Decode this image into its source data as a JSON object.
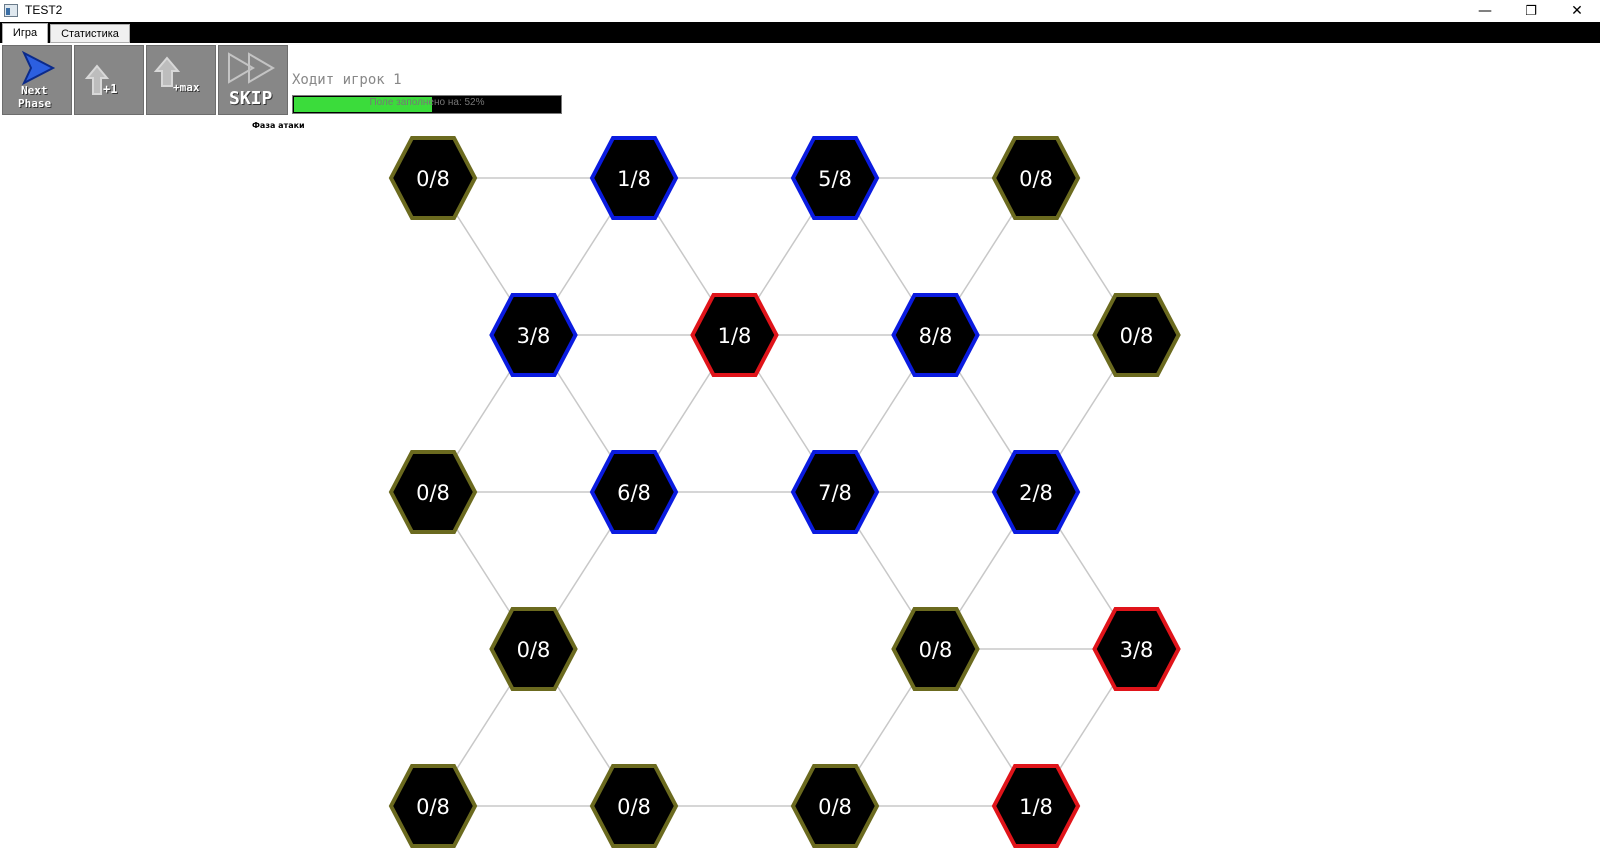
{
  "window": {
    "title": "TEST2",
    "controls": {
      "minimize": "—",
      "maximize": "❐",
      "close": "✕"
    }
  },
  "tabs": [
    {
      "label": "Игра",
      "active": true
    },
    {
      "label": "Статистика",
      "active": false
    }
  ],
  "toolbar": {
    "next_phase": {
      "line1": "Next",
      "line2": "Phase",
      "icon": "play-arrow-icon"
    },
    "plus_one": {
      "label": "+1",
      "icon": "up-arrow-icon"
    },
    "plus_max": {
      "label": "+max",
      "icon": "up-arrow-icon"
    },
    "skip": {
      "label": "SKIP",
      "icon": "double-arrow-icon"
    }
  },
  "status": {
    "player_turn": "Ходит игрок 1",
    "fill_text": "Поле заполнено на: 52%",
    "fill_fraction": 0.52,
    "phase_caption": "Фаза атаки"
  },
  "colors": {
    "neutral": "#6b6a1f",
    "blue": "#0a1be0",
    "red": "#e0141a",
    "link": "#c8c8c8",
    "hex_fill": "#000000",
    "bar_fill": "#3bdc3b"
  },
  "board": {
    "cells": [
      {
        "id": "r0c0",
        "row": 0,
        "col": 0,
        "value": "0/8",
        "owner": "neutral"
      },
      {
        "id": "r0c1",
        "row": 0,
        "col": 1,
        "value": "1/8",
        "owner": "blue"
      },
      {
        "id": "r0c2",
        "row": 0,
        "col": 2,
        "value": "5/8",
        "owner": "blue"
      },
      {
        "id": "r0c3",
        "row": 0,
        "col": 3,
        "value": "0/8",
        "owner": "neutral"
      },
      {
        "id": "r1c0",
        "row": 1,
        "col": 0,
        "value": "3/8",
        "owner": "blue"
      },
      {
        "id": "r1c1",
        "row": 1,
        "col": 1,
        "value": "1/8",
        "owner": "red"
      },
      {
        "id": "r1c2",
        "row": 1,
        "col": 2,
        "value": "8/8",
        "owner": "blue"
      },
      {
        "id": "r1c3",
        "row": 1,
        "col": 3,
        "value": "0/8",
        "owner": "neutral"
      },
      {
        "id": "r2c0",
        "row": 2,
        "col": 0,
        "value": "0/8",
        "owner": "neutral"
      },
      {
        "id": "r2c1",
        "row": 2,
        "col": 1,
        "value": "6/8",
        "owner": "blue"
      },
      {
        "id": "r2c2",
        "row": 2,
        "col": 2,
        "value": "7/8",
        "owner": "blue"
      },
      {
        "id": "r2c3",
        "row": 2,
        "col": 3,
        "value": "2/8",
        "owner": "blue"
      },
      {
        "id": "r3c0",
        "row": 3,
        "col": 0,
        "value": "0/8",
        "owner": "neutral"
      },
      {
        "id": "r3c2",
        "row": 3,
        "col": 2,
        "value": "0/8",
        "owner": "neutral"
      },
      {
        "id": "r3c3",
        "row": 3,
        "col": 3,
        "value": "3/8",
        "owner": "red"
      },
      {
        "id": "r4c0",
        "row": 4,
        "col": 0,
        "value": "0/8",
        "owner": "neutral"
      },
      {
        "id": "r4c1",
        "row": 4,
        "col": 1,
        "value": "0/8",
        "owner": "neutral"
      },
      {
        "id": "r4c2",
        "row": 4,
        "col": 2,
        "value": "0/8",
        "owner": "neutral"
      },
      {
        "id": "r4c3",
        "row": 4,
        "col": 3,
        "value": "1/8",
        "owner": "red"
      }
    ],
    "links": [
      [
        "r0c0",
        "r0c1"
      ],
      [
        "r0c1",
        "r0c2"
      ],
      [
        "r0c2",
        "r0c3"
      ],
      [
        "r0c0",
        "r1c0"
      ],
      [
        "r0c1",
        "r1c0"
      ],
      [
        "r0c1",
        "r1c1"
      ],
      [
        "r0c2",
        "r1c1"
      ],
      [
        "r0c2",
        "r1c2"
      ],
      [
        "r0c3",
        "r1c2"
      ],
      [
        "r0c3",
        "r1c3"
      ],
      [
        "r1c0",
        "r1c1"
      ],
      [
        "r1c1",
        "r1c2"
      ],
      [
        "r1c2",
        "r1c3"
      ],
      [
        "r1c0",
        "r2c0"
      ],
      [
        "r1c0",
        "r2c1"
      ],
      [
        "r1c1",
        "r2c1"
      ],
      [
        "r1c1",
        "r2c2"
      ],
      [
        "r1c2",
        "r2c2"
      ],
      [
        "r1c2",
        "r2c3"
      ],
      [
        "r1c3",
        "r2c3"
      ],
      [
        "r2c0",
        "r2c1"
      ],
      [
        "r2c1",
        "r2c2"
      ],
      [
        "r2c2",
        "r2c3"
      ],
      [
        "r2c0",
        "r3c0"
      ],
      [
        "r2c1",
        "r3c0"
      ],
      [
        "r2c2",
        "r3c2"
      ],
      [
        "r2c3",
        "r3c2"
      ],
      [
        "r2c3",
        "r3c3"
      ],
      [
        "r3c2",
        "r3c3"
      ],
      [
        "r3c0",
        "r4c0"
      ],
      [
        "r3c0",
        "r4c1"
      ],
      [
        "r3c2",
        "r4c2"
      ],
      [
        "r3c2",
        "r4c3"
      ],
      [
        "r3c3",
        "r4c3"
      ],
      [
        "r4c0",
        "r4c1"
      ],
      [
        "r4c1",
        "r4c2"
      ],
      [
        "r4c2",
        "r4c3"
      ]
    ]
  }
}
